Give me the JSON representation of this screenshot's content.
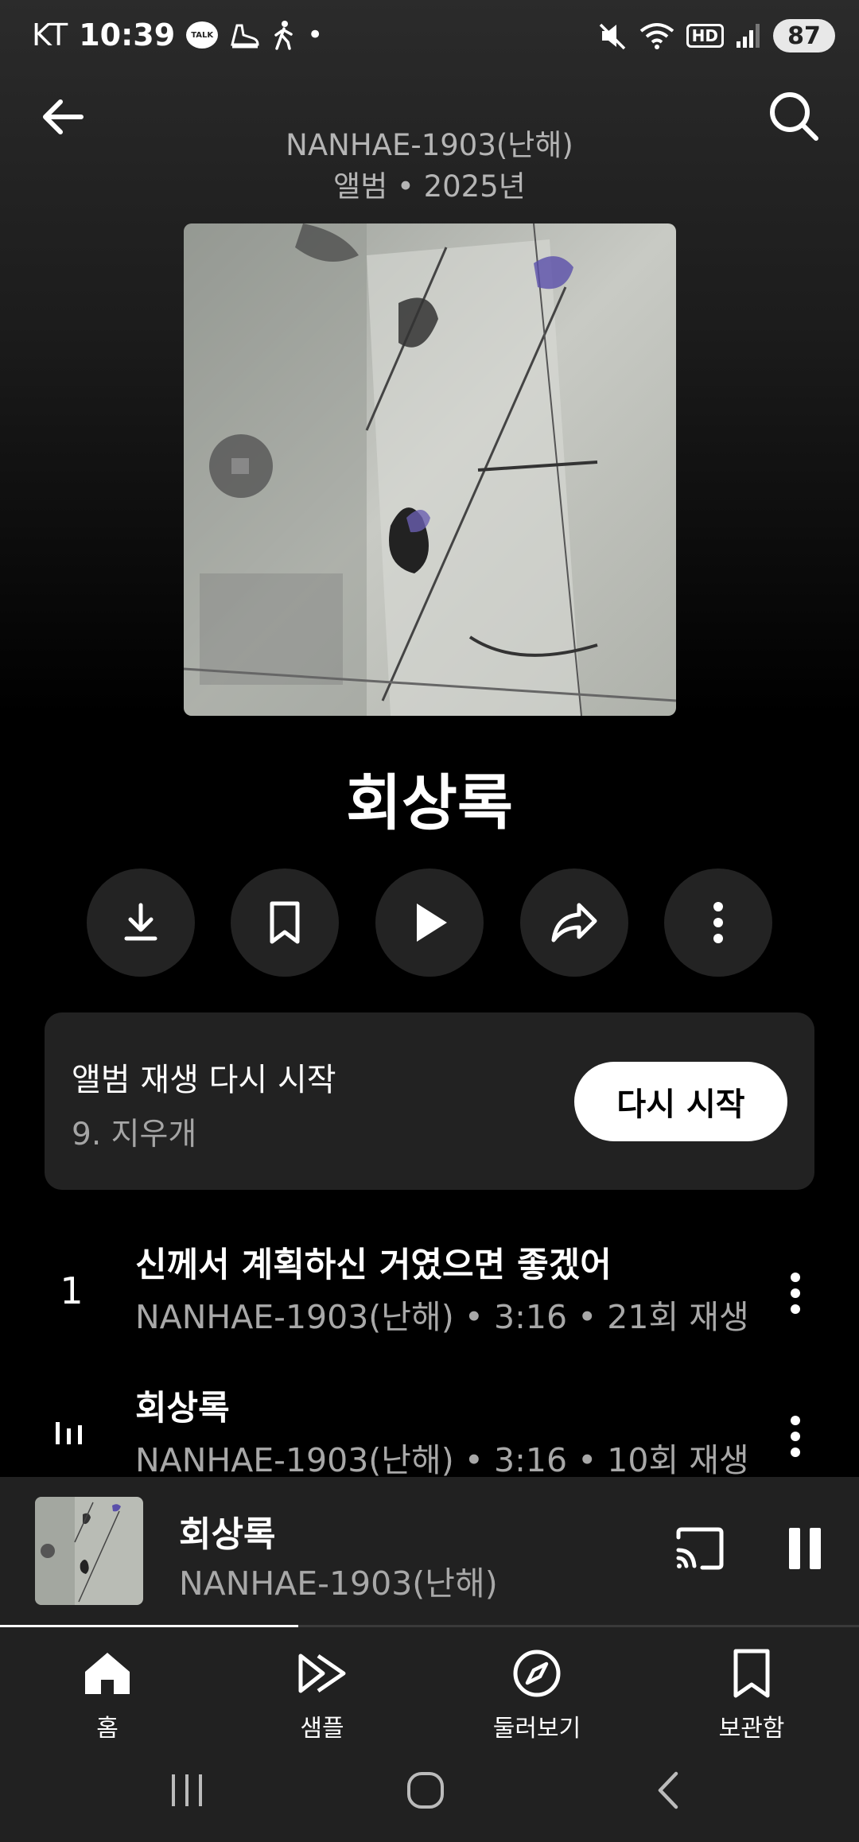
{
  "status_bar": {
    "carrier": "KT",
    "time": "10:39",
    "talk_badge": "TALK",
    "hd_badge": "HD",
    "battery": "87",
    "dot": "•"
  },
  "header": {
    "artist": "NANHAE-1903(난해)",
    "meta": "앨범 • 2025년"
  },
  "album": {
    "title": "회상록"
  },
  "actions": [
    "download-icon",
    "bookmark-icon",
    "play-icon",
    "share-icon",
    "more-icon"
  ],
  "resume": {
    "title": "앨범 재생 다시 시작",
    "subtitle": "9. 지우개",
    "button": "다시 시작"
  },
  "tracks": [
    {
      "number": "1",
      "title": "신께서 계획하신 거였으면 좋겠어",
      "subtitle": "NANHAE-1903(난해) • 3:16 • 21회 재생",
      "playing": false
    },
    {
      "number": "",
      "title": "회상록",
      "subtitle": "NANHAE-1903(난해) • 3:16 • 10회 재생",
      "playing": true
    }
  ],
  "mini_player": {
    "title": "회상록",
    "artist": "NANHAE-1903(난해)",
    "progress": 0.347
  },
  "nav": [
    {
      "label": "홈",
      "icon": "home-icon",
      "active": true
    },
    {
      "label": "샘플",
      "icon": "samples-icon",
      "active": false
    },
    {
      "label": "둘러보기",
      "icon": "explore-icon",
      "active": false
    },
    {
      "label": "보관함",
      "icon": "library-icon",
      "active": false
    }
  ],
  "colors": {
    "background": "#000000",
    "surface": "#212121",
    "card": "#222222",
    "muted_text": "#a8a8a8"
  }
}
